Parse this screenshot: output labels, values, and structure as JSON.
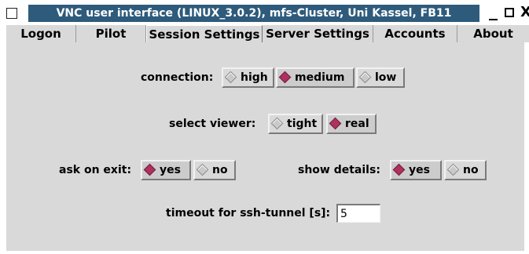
{
  "window": {
    "title": "VNC user interface (LINUX_3.0.2), mfs-Cluster, Uni Kassel, FB11",
    "close_glyph": "X"
  },
  "tabs": [
    {
      "label": "Logon",
      "active": false
    },
    {
      "label": "Pilot",
      "active": false
    },
    {
      "label": "Session Settings",
      "active": true
    },
    {
      "label": "Server Settings",
      "active": false
    },
    {
      "label": "Accounts",
      "active": false
    },
    {
      "label": "About",
      "active": false
    }
  ],
  "session": {
    "connection": {
      "label": "connection:",
      "options": [
        "high",
        "medium",
        "low"
      ],
      "selected": "medium"
    },
    "viewer": {
      "label": "select viewer:",
      "options": [
        "tight",
        "real"
      ],
      "selected": "real"
    },
    "ask_on_exit": {
      "label": "ask on exit:",
      "options": [
        "yes",
        "no"
      ],
      "selected": "yes"
    },
    "show_details": {
      "label": "show details:",
      "options": [
        "yes",
        "no"
      ],
      "selected": "yes"
    },
    "timeout": {
      "label": "timeout for ssh-tunnel [s]:",
      "value": "5"
    }
  },
  "colors": {
    "titlebar": "#2e5b7c",
    "panel": "#d9d9d9",
    "radio_selected": "#b03060"
  }
}
